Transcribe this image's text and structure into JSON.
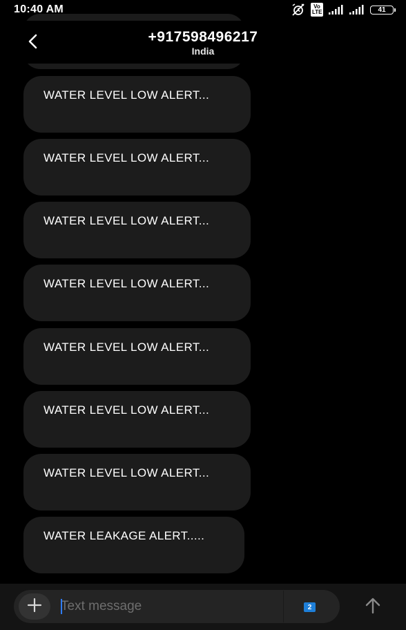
{
  "status_bar": {
    "time": "10:40 AM",
    "volte_label": "Vo LTE",
    "battery_level": "41",
    "icons": [
      "alarm-off-icon",
      "volte-icon",
      "signal-icon",
      "signal-icon",
      "battery-icon"
    ]
  },
  "header": {
    "contact_number": "+917598496217",
    "contact_country": "India",
    "back_icon": "chevron-left-icon"
  },
  "messages": [
    {
      "text": "WATER LEVEL LOW ALERT..."
    },
    {
      "text": "WATER LEVEL LOW ALERT..."
    },
    {
      "text": "WATER LEVEL LOW ALERT..."
    },
    {
      "text": "WATER LEVEL LOW ALERT..."
    },
    {
      "text": "WATER LEVEL LOW ALERT..."
    },
    {
      "text": "WATER LEVEL LOW ALERT..."
    },
    {
      "text": "WATER LEVEL LOW ALERT..."
    },
    {
      "text": "WATER LEAKAGE ALERT....."
    }
  ],
  "compose": {
    "placeholder": "Text message",
    "value": "",
    "sim_slot": "2",
    "add_icon": "plus-icon",
    "send_icon": "arrow-up-icon"
  },
  "colors": {
    "background": "#000000",
    "bubble": "#1c1c1c",
    "compose_bar": "#141414",
    "accent": "#1e7fd8"
  }
}
